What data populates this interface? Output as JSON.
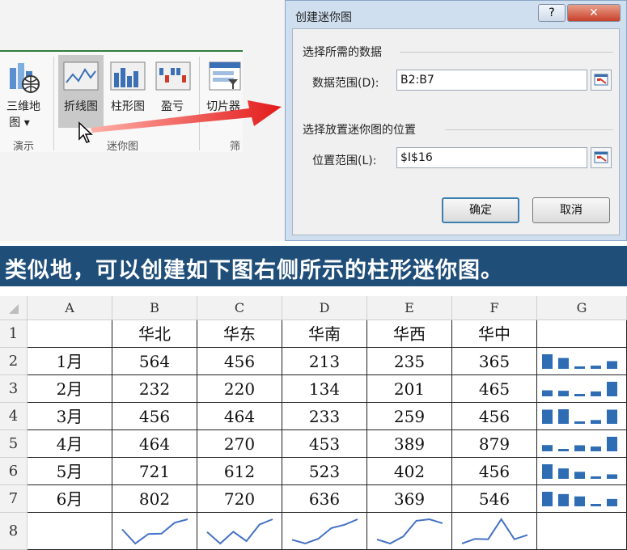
{
  "ribbon": {
    "buttons": [
      {
        "label": "三维地",
        "label2": "图 ▾",
        "icon": "3d-map-icon"
      },
      {
        "label": "折线图",
        "icon": "line-sparkline-icon"
      },
      {
        "label": "柱形图",
        "icon": "column-sparkline-icon"
      },
      {
        "label": "盈亏",
        "icon": "win-loss-sparkline-icon"
      },
      {
        "label": "切片器",
        "icon": "slicer-icon"
      }
    ],
    "groups": [
      "演示",
      "迷你图",
      "筛"
    ]
  },
  "dialog": {
    "title": "创建迷你图",
    "help": "?",
    "close": "✕",
    "section1": "选择所需的数据",
    "data_range_label": "数据范围(D):",
    "data_range_value": "B2:B7",
    "section2": "选择放置迷你图的位置",
    "location_label": "位置范围(L):",
    "location_value": "$I$16",
    "ok": "确定",
    "cancel": "取消"
  },
  "banner": "类似地，可以创建如下图右侧所示的柱形迷你图。",
  "table": {
    "columns": [
      "A",
      "B",
      "C",
      "D",
      "E",
      "F",
      "G"
    ],
    "rows": [
      "1",
      "2",
      "3",
      "4",
      "5",
      "6",
      "7",
      "8"
    ],
    "headers": [
      "华北",
      "华东",
      "华南",
      "华西",
      "华中"
    ],
    "months": [
      "1月",
      "2月",
      "3月",
      "4月",
      "5月",
      "6月"
    ],
    "values": [
      [
        564,
        456,
        213,
        235,
        365
      ],
      [
        232,
        220,
        134,
        201,
        465
      ],
      [
        456,
        464,
        233,
        259,
        456
      ],
      [
        464,
        270,
        453,
        389,
        879
      ],
      [
        721,
        612,
        523,
        402,
        456
      ],
      [
        802,
        720,
        636,
        369,
        546
      ]
    ]
  },
  "colors": {
    "banner": "#1f4e79",
    "sparkline_column": "#2e6db4",
    "sparkline_line": "#4472c4",
    "arrow": "#e02020"
  }
}
